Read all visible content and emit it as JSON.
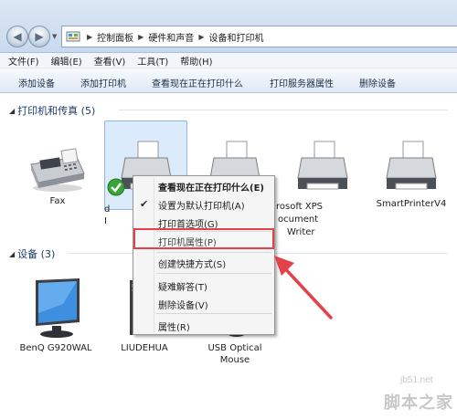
{
  "address_bar": {
    "breadcrumbs": [
      "控制面板",
      "硬件和声音",
      "设备和打印机"
    ]
  },
  "menu": {
    "items": [
      "文件(F)",
      "编辑(E)",
      "查看(V)",
      "工具(T)",
      "帮助(H)"
    ]
  },
  "toolbar": {
    "buttons": [
      "添加设备",
      "添加打印机",
      "查看现在正在打印什么",
      "打印服务器属性",
      "删除设备"
    ]
  },
  "printers_group": {
    "header": "打印机和传真 (5)",
    "devices": [
      {
        "label": "Fax"
      },
      {
        "label": "d\nI"
      },
      {
        "label": ""
      },
      {
        "label": "rosoft XPS\nocument\nWriter"
      },
      {
        "label": "SmartPrinterV4"
      }
    ]
  },
  "devices_group": {
    "header": "设备 (3)",
    "devices": [
      {
        "label": "BenQ G920WAL"
      },
      {
        "label": "LIUDEHUA"
      },
      {
        "label": "USB Optical\nMouse"
      }
    ]
  },
  "context_menu": {
    "items": [
      {
        "label": "查看现在正在打印什么(E)",
        "bold": true
      },
      {
        "label": "设置为默认打印机(A)",
        "checked": true
      },
      {
        "label": "打印首选项(G)"
      },
      {
        "label": "打印机属性(P)",
        "highlighted": true
      },
      {
        "label": "创建快捷方式(S)"
      },
      {
        "label": "疑难解答(T)"
      },
      {
        "label": "删除设备(V)"
      },
      {
        "label": "属性(R)"
      }
    ],
    "highlight_color": "#e3424b"
  },
  "annotation": {
    "arrow_color": "#e3424b"
  },
  "watermark": {
    "site": "jb51.net",
    "name": "脚本之家"
  }
}
